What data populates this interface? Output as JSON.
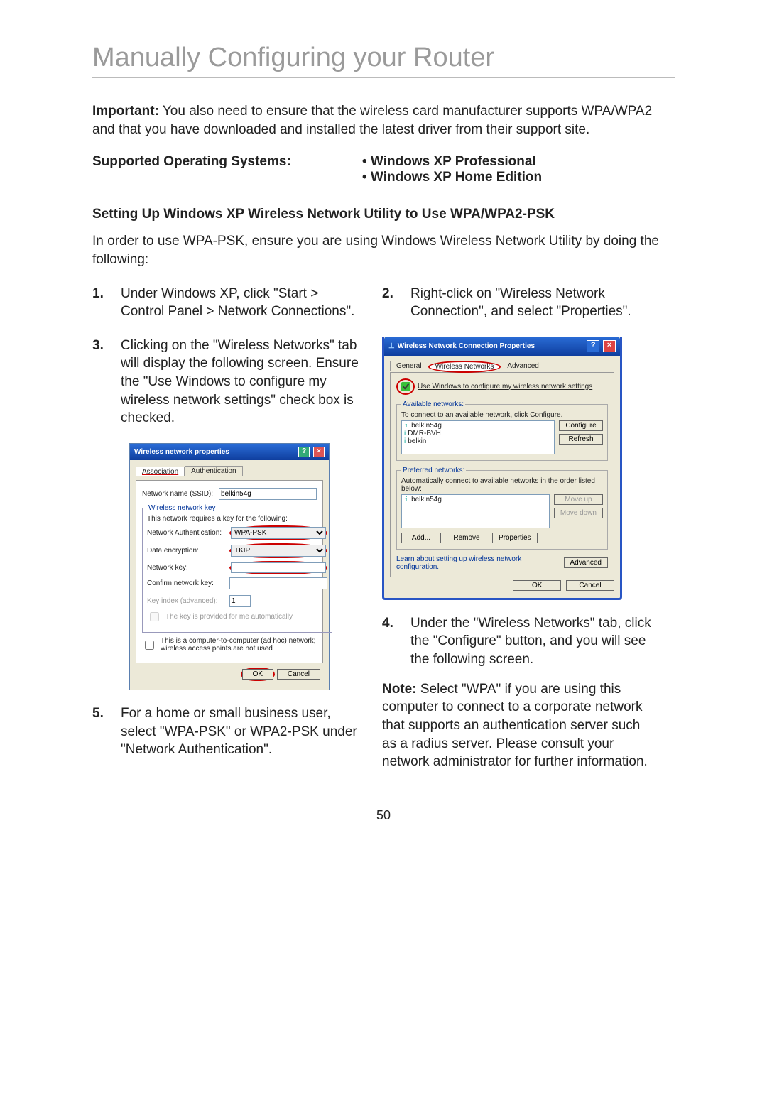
{
  "page": {
    "title": "Manually Configuring your Router",
    "important_label": "Important:",
    "important_text": " You also need to ensure that the wireless card manufacturer supports WPA/WPA2 and that you have downloaded and installed the latest driver from their support site.",
    "supported_label": "Supported Operating Systems:",
    "os1": "• Windows XP Professional",
    "os2": "• Windows XP Home Edition",
    "subheading": "Setting Up Windows XP Wireless Network Utility to Use WPA/WPA2-PSK",
    "intro2": "In order to use WPA-PSK, ensure you are using Windows Wireless Network Utility by doing the following:",
    "steps": {
      "s1num": "1.",
      "s1": "Under Windows XP, click \"Start > Control Panel > Network Connections\".",
      "s2num": "2.",
      "s2": "Right-click on \"Wireless Network Connection\", and select \"Properties\".",
      "s3num": "3.",
      "s3": "Clicking on the \"Wireless Networks\" tab will display the following screen. Ensure the \"Use Windows to configure my wireless network settings\" check box is checked.",
      "s4num": "4.",
      "s4": "Under the \"Wireless Networks\" tab, click the \"Configure\" button, and you will see the following screen.",
      "s5num": "5.",
      "s5": "For a home or small business user, select \"WPA-PSK\" or WPA2-PSK under \"Network Authentication\"."
    },
    "note_label": "Note:",
    "note_text": " Select \"WPA\" if you are using this computer to connect to a corporate network that supports an authentication server such as a radius server. Please consult your network administrator for further information.",
    "page_number": "50"
  },
  "dialog1": {
    "title": "Wireless network properties",
    "tabs": {
      "t1": "Association",
      "t2": "Authentication"
    },
    "ssid_label": "Network name (SSID):",
    "ssid_value": "belkin54g",
    "legend": "Wireless network key",
    "req_text": "This network requires a key for the following:",
    "auth_label": "Network Authentication:",
    "auth_value": "WPA-PSK",
    "enc_label": "Data encryption:",
    "enc_value": "TKIP",
    "key_label": "Network key:",
    "confirm_label": "Confirm network key:",
    "idx_label": "Key index (advanced):",
    "idx_value": "1",
    "auto_label": "The key is provided for me automatically",
    "adhoc_label": "This is a computer-to-computer (ad hoc) network; wireless access points are not used",
    "ok": "OK",
    "cancel": "Cancel"
  },
  "dialog2": {
    "title": "Wireless Network Connection Properties",
    "tabs": {
      "t1": "General",
      "t2": "Wireless Networks",
      "t3": "Advanced"
    },
    "checkbox": "Use Windows to configure my wireless network settings",
    "avail_legend": "Available networks:",
    "avail_hint": "To connect to an available network, click Configure.",
    "avail_items": [
      "belkin54g",
      "DMR-BVH",
      "belkin"
    ],
    "btn_configure": "Configure",
    "btn_refresh": "Refresh",
    "pref_legend": "Preferred networks:",
    "pref_hint": "Automatically connect to available networks in the order listed below:",
    "pref_items": [
      "belkin54g"
    ],
    "btn_moveup": "Move up",
    "btn_movedown": "Move down",
    "btn_add": "Add...",
    "btn_remove": "Remove",
    "btn_props": "Properties",
    "learn": "Learn about setting up wireless network configuration.",
    "btn_adv": "Advanced",
    "ok": "OK",
    "cancel": "Cancel"
  }
}
